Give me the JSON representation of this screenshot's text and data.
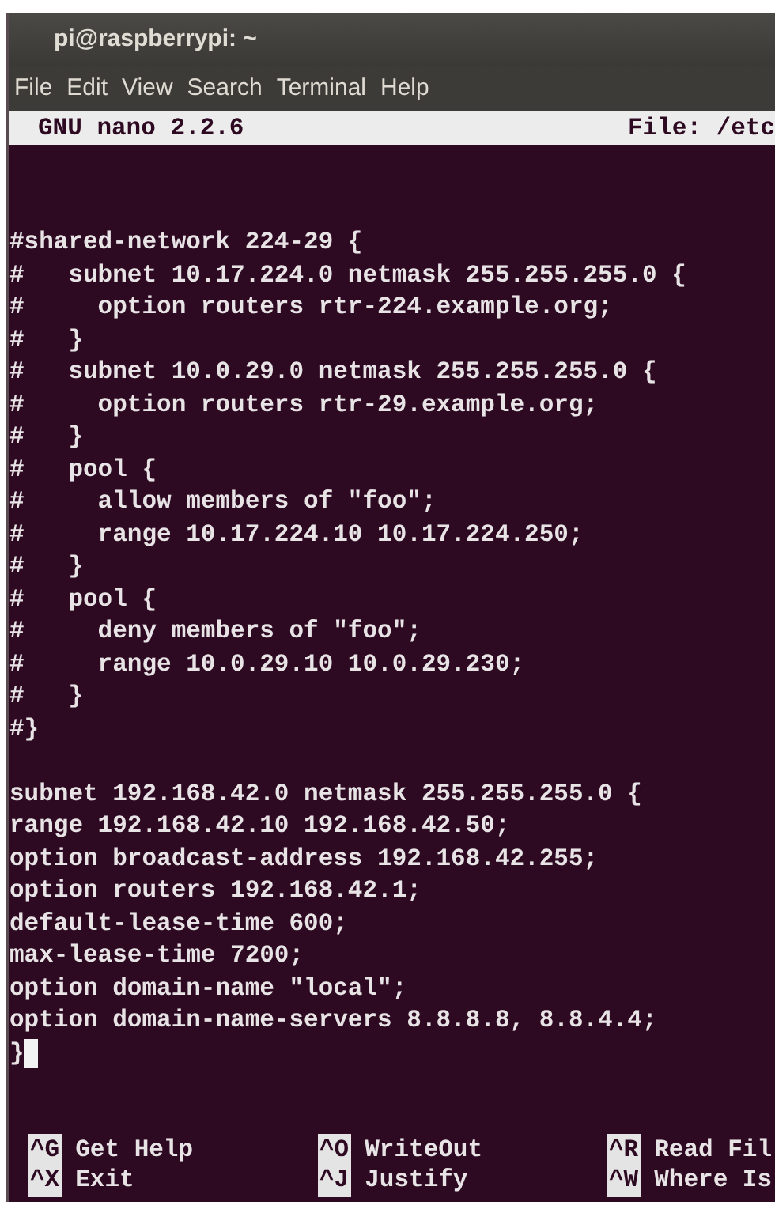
{
  "window": {
    "title": "pi@raspberrypi: ~"
  },
  "menu": [
    "File",
    "Edit",
    "View",
    "Search",
    "Terminal",
    "Help"
  ],
  "nano_header": {
    "version": "GNU nano 2.2.6",
    "file": "File: /etc"
  },
  "editor": {
    "blocks": [
      [
        "#shared-network 224-29 {",
        "#   subnet 10.17.224.0 netmask 255.255.255.0 {",
        "#     option routers rtr-224.example.org;",
        "#   }",
        "#   subnet 10.0.29.0 netmask 255.255.255.0 {",
        "#     option routers rtr-29.example.org;",
        "#   }",
        "#   pool {",
        "#     allow members of \"foo\";",
        "#     range 10.17.224.10 10.17.224.250;",
        "#   }",
        "#   pool {",
        "#     deny members of \"foo\";",
        "#     range 10.0.29.10 10.0.29.230;",
        "#   }",
        "#}"
      ],
      [
        "subnet 192.168.42.0 netmask 255.255.255.0 {",
        "range 192.168.42.10 192.168.42.50;",
        "option broadcast-address 192.168.42.255;",
        "option routers 192.168.42.1;",
        "default-lease-time 600;",
        "max-lease-time 7200;",
        "option domain-name \"local\";",
        "option domain-name-servers 8.8.8.8, 8.8.4.4;",
        "}"
      ]
    ]
  },
  "shortcuts": [
    [
      {
        "key": "^G",
        "label": "Get Help"
      },
      {
        "key": "^O",
        "label": "WriteOut"
      },
      {
        "key": "^R",
        "label": "Read Fil"
      }
    ],
    [
      {
        "key": "^X",
        "label": "Exit"
      },
      {
        "key": "^J",
        "label": "Justify"
      },
      {
        "key": "^W",
        "label": "Where Is"
      }
    ]
  ]
}
